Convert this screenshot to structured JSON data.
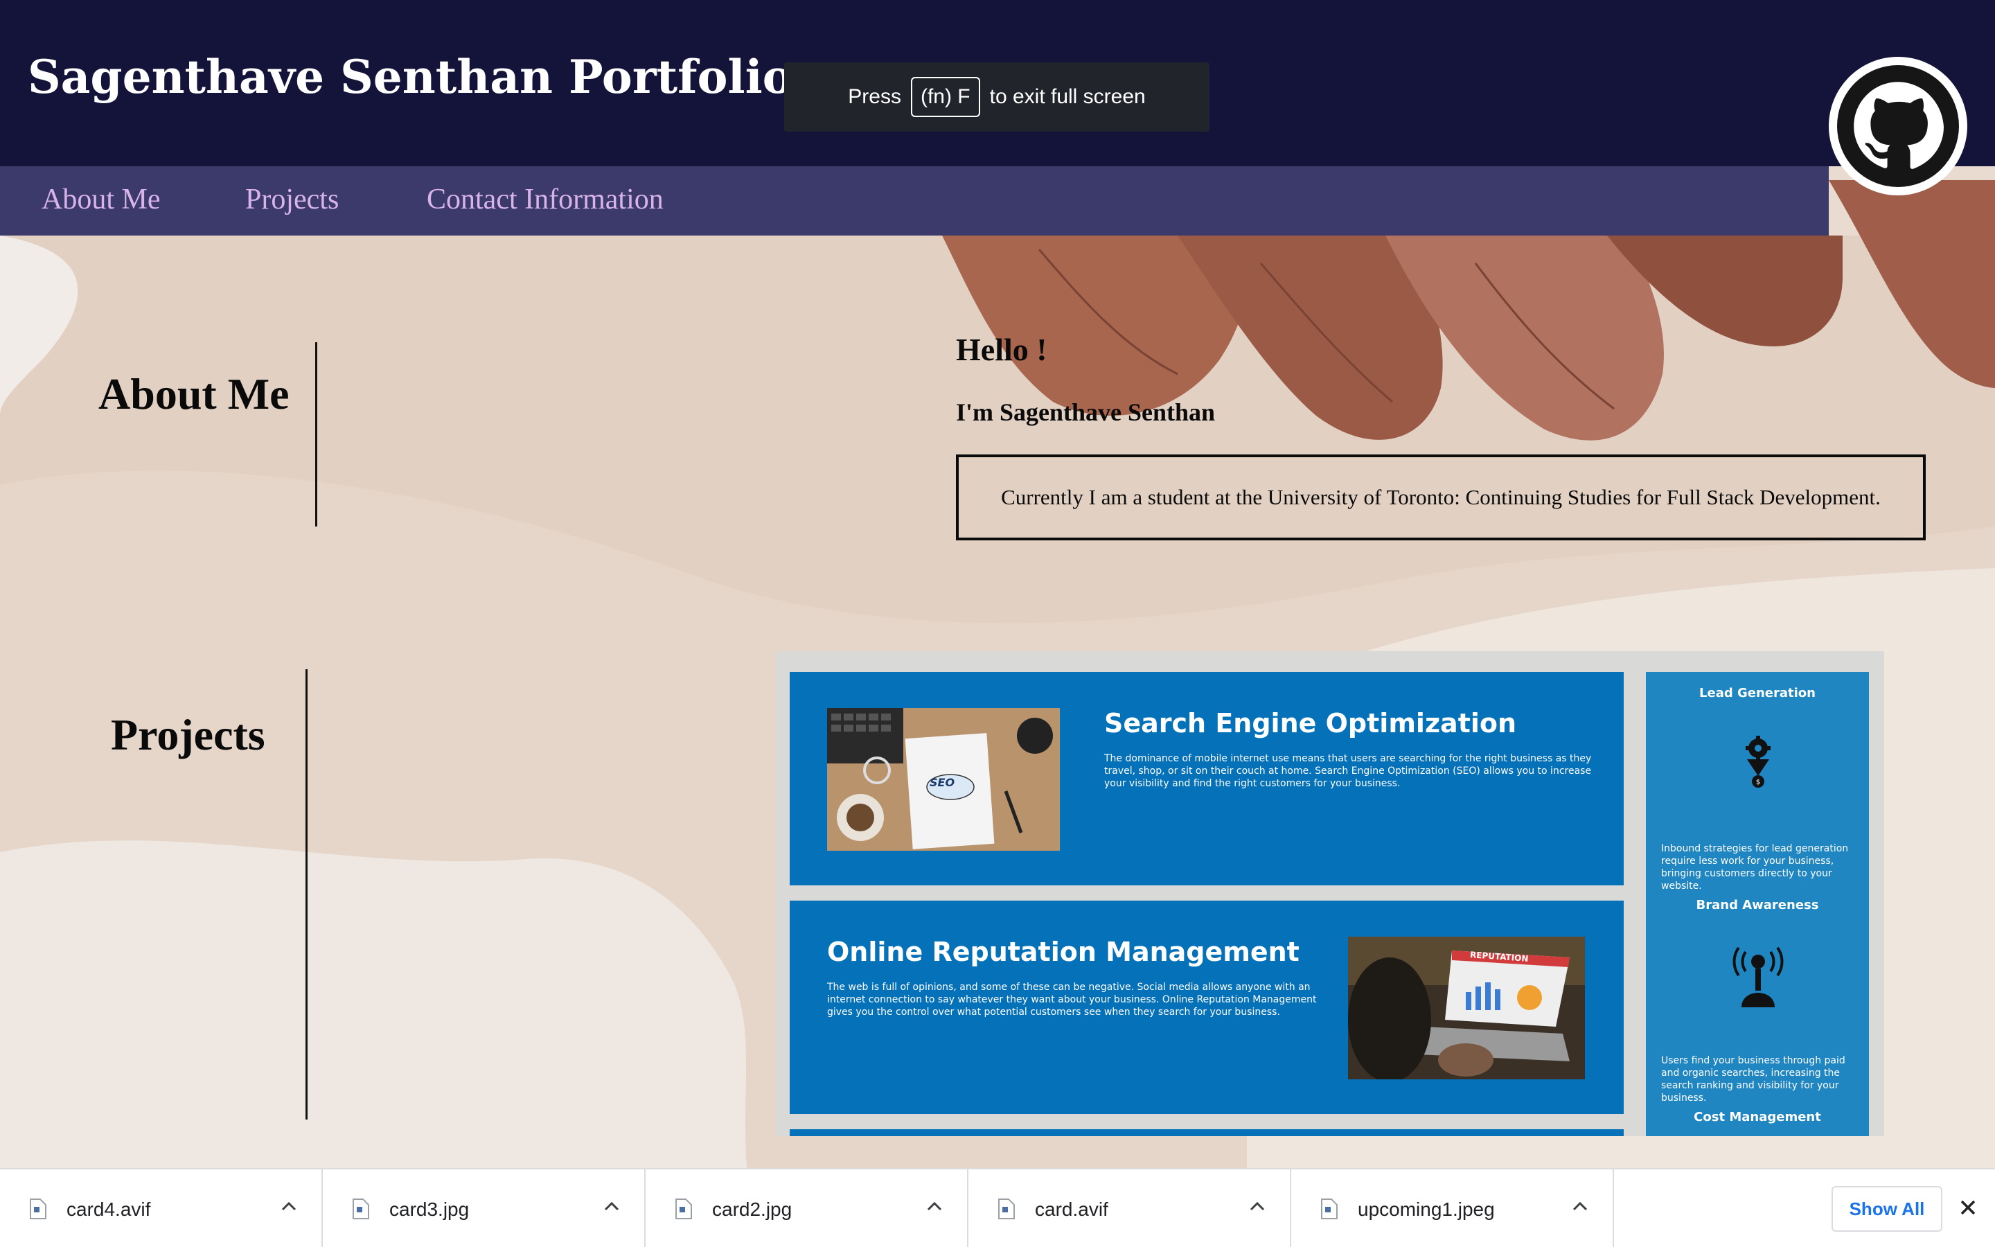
{
  "header": {
    "title": "Sagenthave Senthan Portfolio",
    "fullscreen_notice": {
      "prefix": "Press",
      "key": "(fn) F",
      "suffix": "to exit full screen"
    },
    "github_icon": "github-icon"
  },
  "nav": {
    "items": [
      "About Me",
      "Projects",
      "Contact Information"
    ]
  },
  "about": {
    "heading": "About Me",
    "greeting": "Hello !",
    "intro": "I'm Sagenthave Senthan",
    "bio": "Currently I am a student at the University of Toronto: Continuing Studies for Full Stack Development."
  },
  "projects": {
    "heading": "Projects",
    "preview": {
      "cards": [
        {
          "title": "Search Engine Optimization",
          "description": "The dominance of mobile internet use means that users are searching for the right business as they travel, shop, or sit on their couch at home. Search Engine Optimization (SEO) allows you to increase your visibility and find the right customers for your business.",
          "image_text": "SEO"
        },
        {
          "title": "Online Reputation Management",
          "description": "The web is full of opinions, and some of these can be negative. Social media allows anyone with an internet connection to say whatever they want about your business. Online Reputation Management gives you the control over what potential customers see when they search for your business.",
          "image_text": "REPUTATION"
        }
      ],
      "benefits": [
        {
          "title": "Lead Generation",
          "icon": "gear-money-icon",
          "text": "Inbound strategies for lead generation require less work for your business, bringing customers directly to your website."
        },
        {
          "title": "Brand Awareness",
          "icon": "broadcast-person-icon",
          "text": "Users find your business through paid and organic searches, increasing the search ranking and visibility for your business."
        },
        {
          "title": "Cost Management",
          "icon": "",
          "text": ""
        }
      ]
    }
  },
  "downloads": {
    "items": [
      "card4.avif",
      "card3.jpg",
      "card2.jpg",
      "card.avif",
      "upcoming1.jpeg"
    ],
    "show_all_label": "Show All"
  },
  "colors": {
    "header_bg": "#14143a",
    "nav_bg": "#3b3a6a",
    "nav_link": "#d9b4e8",
    "card_blue": "#0471b9",
    "sidebar_blue": "#1f86c1",
    "show_all_blue": "#1a73e8"
  }
}
